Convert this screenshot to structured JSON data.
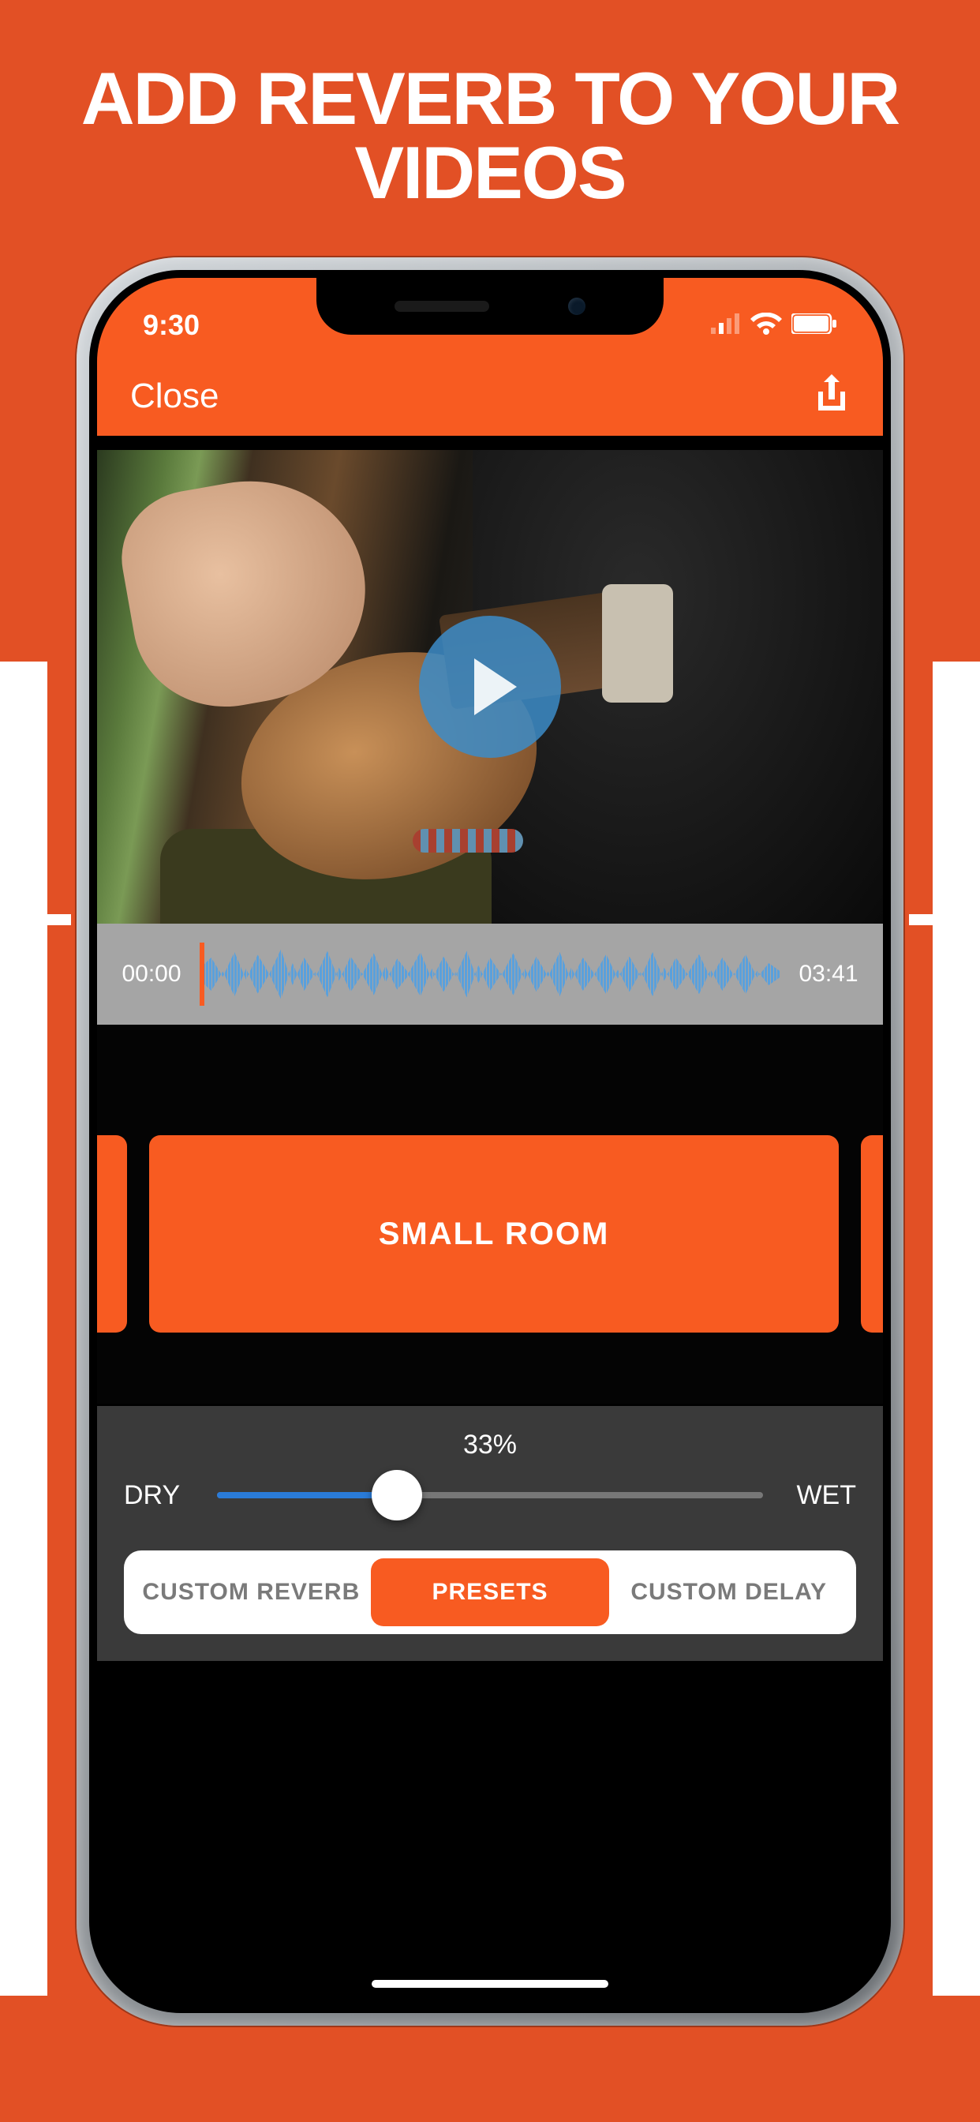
{
  "promo": {
    "title": "ADD REVERB TO YOUR VIDEOS"
  },
  "status": {
    "time": "9:30"
  },
  "nav": {
    "close_label": "Close"
  },
  "timeline": {
    "start": "00:00",
    "end": "03:41"
  },
  "preset": {
    "selected": "SMALL ROOM"
  },
  "mix": {
    "percent_label": "33%",
    "percent_value": 33,
    "dry_label": "DRY",
    "wet_label": "WET"
  },
  "segments": {
    "custom_reverb": "CUSTOM REVERB",
    "presets": "PRESETS",
    "custom_delay": "CUSTOM DELAY",
    "active": "presets"
  }
}
